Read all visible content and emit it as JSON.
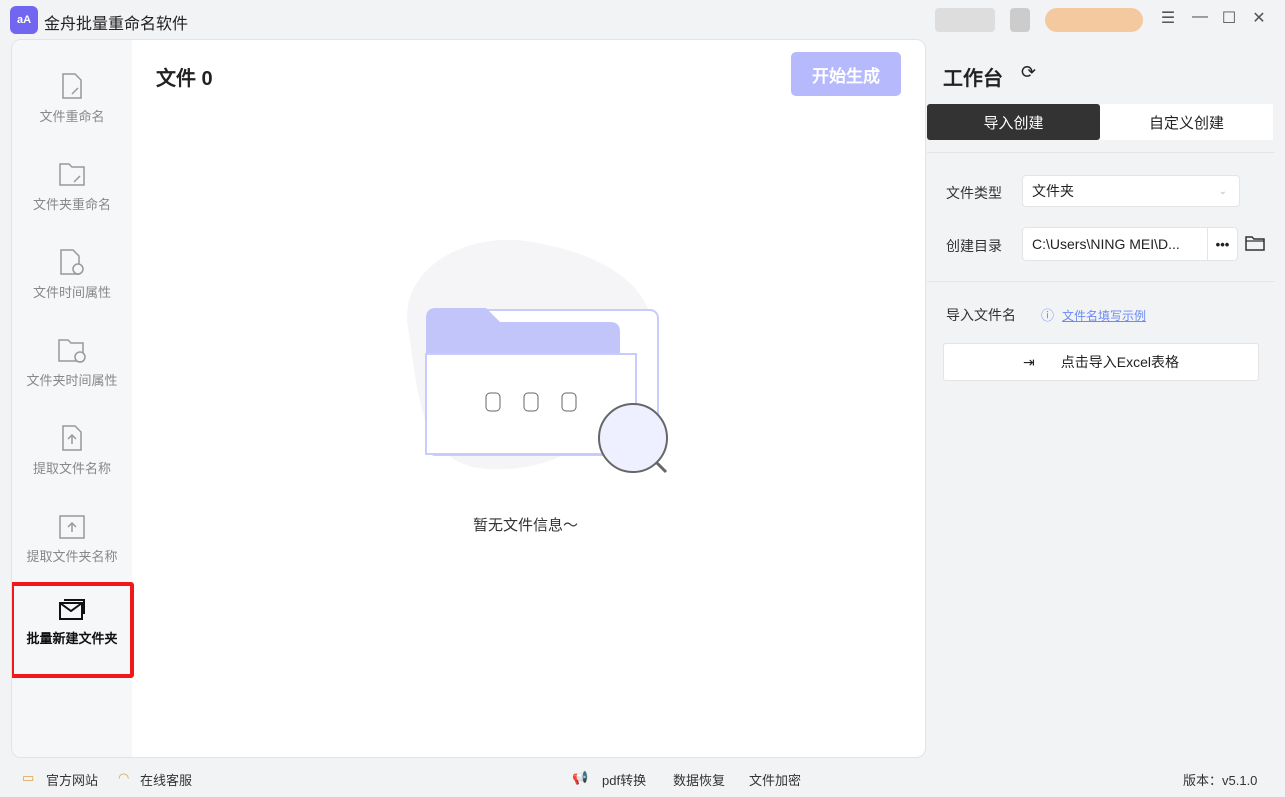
{
  "app": {
    "logo_text": "aA",
    "title": "金舟批量重命名软件"
  },
  "sidebar": {
    "items": [
      {
        "label": "文件重命名",
        "icon": "file-edit-icon"
      },
      {
        "label": "文件夹重命名",
        "icon": "folder-edit-icon"
      },
      {
        "label": "文件时间属性",
        "icon": "file-clock-icon"
      },
      {
        "label": "文件夹时间属性",
        "icon": "folder-clock-icon"
      },
      {
        "label": "提取文件名称",
        "icon": "file-upload-icon"
      },
      {
        "label": "提取文件夹名称",
        "icon": "folder-upload-icon"
      },
      {
        "label": "批量新建文件夹",
        "icon": "folders-icon",
        "active": true
      }
    ]
  },
  "main": {
    "title": "文件 0",
    "start_button": "开始生成",
    "empty_text": "暂无文件信息～"
  },
  "workbench": {
    "title": "工作台",
    "tabs": [
      "导入创建",
      "自定义创建"
    ],
    "file_type_label": "文件类型",
    "file_type_value": "文件夹",
    "dir_label": "创建目录",
    "dir_value": "C:\\Users\\NING MEI\\D...",
    "more": "•••",
    "import_label": "导入文件名",
    "example_link": "文件名填写示例",
    "import_button": "点击导入Excel表格"
  },
  "footer": {
    "website": "官方网站",
    "service": "在线客服",
    "pdf": "pdf转换",
    "recover": "数据恢复",
    "encrypt": "文件加密",
    "version": "版本：v5.1.0"
  },
  "colors": {
    "accent": "#b6b9fb",
    "active_tab": "#333333",
    "highlight": "#f01818"
  }
}
